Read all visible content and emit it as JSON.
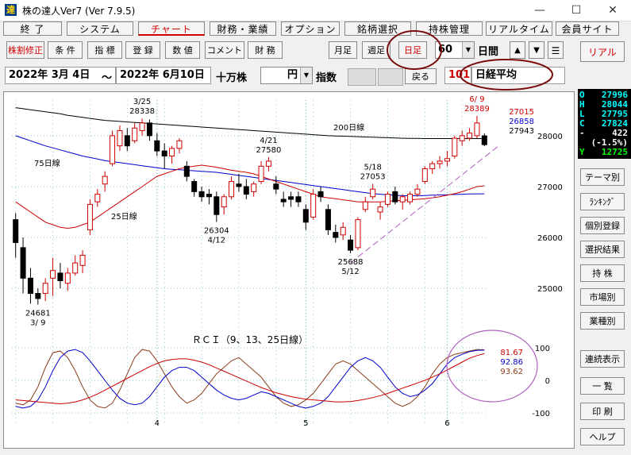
{
  "window": {
    "title": "株の達人Ver7 (Ver 7.9.5)",
    "app_icon": "達"
  },
  "menu": [
    {
      "label": "終 了"
    },
    {
      "label": "システム"
    },
    {
      "label": "チャート"
    },
    {
      "label": "財務・業績"
    },
    {
      "label": "オプション"
    },
    {
      "label": "銘柄選択"
    },
    {
      "label": "持株管理"
    },
    {
      "label": "リアルタイム"
    },
    {
      "label": "会員サイト"
    }
  ],
  "toolbar": {
    "buttons": [
      "株割修正",
      "条 件",
      "指 標",
      "登 録",
      "数 値",
      "コメント",
      "財 務"
    ],
    "period_buttons": [
      "月足",
      "週足",
      "日足"
    ],
    "count": "60",
    "unit": "日間",
    "real_label": "リアル"
  },
  "range": {
    "start": "2022年 3月 4日",
    "sep": "〜",
    "end": "2022年 6月10日",
    "unit1": "十万株",
    "unit2": "円",
    "kind": "指数",
    "back": "戻る",
    "code": "101",
    "name": "日経平均"
  },
  "ohlc": [
    {
      "k": "O",
      "v": "27996",
      "color": "#00ffff"
    },
    {
      "k": "H",
      "v": "28044",
      "color": "#00ffff"
    },
    {
      "k": "L",
      "v": "27795",
      "color": "#00ffff"
    },
    {
      "k": "C",
      "v": "27824",
      "color": "#00ffff"
    },
    {
      "k": "-",
      "v": "422",
      "color": "#ffffff"
    },
    {
      "k": "",
      "v": "(-1.5%)",
      "color": "#ffffff"
    },
    {
      "k": "Y",
      "v": "12725",
      "color": "#00ff00"
    }
  ],
  "side_buttons": [
    "テーマ別",
    "ﾗﾝｷﾝｸﾞ",
    "個別登録",
    "選択結果",
    "持 株",
    "市場別",
    "業種別",
    "連続表示",
    "一 覧",
    "印 刷",
    "ヘルプ"
  ],
  "chart_data": {
    "type": "candlestick",
    "title": "",
    "price_axis": {
      "ticks": [
        28000,
        27000,
        26000,
        25000
      ],
      "ylim": [
        24300,
        28700
      ]
    },
    "x_month_labels": [
      "4",
      "5",
      "6"
    ],
    "candles": [
      {
        "o": 26350,
        "h": 26480,
        "l": 25600,
        "c": 25900
      },
      {
        "o": 25800,
        "h": 26000,
        "l": 24900,
        "c": 25200
      },
      {
        "o": 25200,
        "h": 25400,
        "l": 24700,
        "c": 24900
      },
      {
        "o": 24900,
        "h": 25000,
        "l": 24681,
        "c": 24800
      },
      {
        "o": 24900,
        "h": 25200,
        "l": 24750,
        "c": 25100
      },
      {
        "o": 25200,
        "h": 25600,
        "l": 24850,
        "c": 25350
      },
      {
        "o": 25300,
        "h": 25500,
        "l": 25000,
        "c": 25150
      },
      {
        "o": 25100,
        "h": 25400,
        "l": 24950,
        "c": 25300
      },
      {
        "o": 25300,
        "h": 25650,
        "l": 25250,
        "c": 25500
      },
      {
        "o": 25450,
        "h": 25750,
        "l": 25300,
        "c": 25650
      },
      {
        "o": 26150,
        "h": 26750,
        "l": 26050,
        "c": 26650
      },
      {
        "o": 26700,
        "h": 26950,
        "l": 26600,
        "c": 26850
      },
      {
        "o": 27050,
        "h": 27300,
        "l": 26900,
        "c": 27200
      },
      {
        "o": 27450,
        "h": 28100,
        "l": 27400,
        "c": 28000
      },
      {
        "o": 27800,
        "h": 28200,
        "l": 27700,
        "c": 28100
      },
      {
        "o": 28000,
        "h": 28150,
        "l": 27700,
        "c": 27800
      },
      {
        "o": 27900,
        "h": 28250,
        "l": 27850,
        "c": 28150
      },
      {
        "o": 28100,
        "h": 28338,
        "l": 28000,
        "c": 28250
      },
      {
        "o": 28250,
        "h": 28320,
        "l": 27900,
        "c": 28000
      },
      {
        "o": 27900,
        "h": 28050,
        "l": 27600,
        "c": 27700
      },
      {
        "o": 27700,
        "h": 27850,
        "l": 27350,
        "c": 27600
      },
      {
        "o": 27600,
        "h": 27800,
        "l": 27450,
        "c": 27750
      },
      {
        "o": 27750,
        "h": 27950,
        "l": 27650,
        "c": 27900
      },
      {
        "o": 27400,
        "h": 27500,
        "l": 27100,
        "c": 27200
      },
      {
        "o": 27100,
        "h": 27150,
        "l": 26800,
        "c": 26900
      },
      {
        "o": 26900,
        "h": 27000,
        "l": 26700,
        "c": 26800
      },
      {
        "o": 26850,
        "h": 26950,
        "l": 26650,
        "c": 26800
      },
      {
        "o": 26800,
        "h": 26900,
        "l": 26304,
        "c": 26450
      },
      {
        "o": 26600,
        "h": 26850,
        "l": 26450,
        "c": 26800
      },
      {
        "o": 26800,
        "h": 27200,
        "l": 26750,
        "c": 27100
      },
      {
        "o": 27050,
        "h": 27250,
        "l": 26900,
        "c": 27000
      },
      {
        "o": 27000,
        "h": 27150,
        "l": 26750,
        "c": 26850
      },
      {
        "o": 26900,
        "h": 27100,
        "l": 26800,
        "c": 27050
      },
      {
        "o": 27100,
        "h": 27500,
        "l": 27050,
        "c": 27400
      },
      {
        "o": 27400,
        "h": 27580,
        "l": 27300,
        "c": 27500
      },
      {
        "o": 27050,
        "h": 27200,
        "l": 26850,
        "c": 26950
      },
      {
        "o": 26750,
        "h": 26900,
        "l": 26600,
        "c": 26700
      },
      {
        "o": 26800,
        "h": 26900,
        "l": 26600,
        "c": 26750
      },
      {
        "o": 26800,
        "h": 26900,
        "l": 26600,
        "c": 26700
      },
      {
        "o": 26550,
        "h": 26650,
        "l": 26150,
        "c": 26300
      },
      {
        "o": 26400,
        "h": 26950,
        "l": 26350,
        "c": 26850
      },
      {
        "o": 26900,
        "h": 27000,
        "l": 26700,
        "c": 26800
      },
      {
        "o": 26550,
        "h": 26650,
        "l": 26050,
        "c": 26150
      },
      {
        "o": 26100,
        "h": 26250,
        "l": 25900,
        "c": 26000
      },
      {
        "o": 26050,
        "h": 26300,
        "l": 25950,
        "c": 26200
      },
      {
        "o": 25950,
        "h": 26050,
        "l": 25688,
        "c": 25750
      },
      {
        "o": 25800,
        "h": 26400,
        "l": 25750,
        "c": 26350
      },
      {
        "o": 26550,
        "h": 26800,
        "l": 26500,
        "c": 26700
      },
      {
        "o": 26800,
        "h": 27053,
        "l": 26750,
        "c": 26950
      },
      {
        "o": 26500,
        "h": 26700,
        "l": 26350,
        "c": 26600
      },
      {
        "o": 26650,
        "h": 26900,
        "l": 26600,
        "c": 26850
      },
      {
        "o": 26900,
        "h": 27000,
        "l": 26650,
        "c": 26700
      },
      {
        "o": 26700,
        "h": 26850,
        "l": 26550,
        "c": 26800
      },
      {
        "o": 26700,
        "h": 26900,
        "l": 26650,
        "c": 26850
      },
      {
        "o": 26850,
        "h": 27050,
        "l": 26800,
        "c": 26950
      },
      {
        "o": 27100,
        "h": 27400,
        "l": 27050,
        "c": 27350
      },
      {
        "o": 27350,
        "h": 27500,
        "l": 27250,
        "c": 27450
      },
      {
        "o": 27450,
        "h": 27600,
        "l": 27350,
        "c": 27500
      },
      {
        "o": 27500,
        "h": 27700,
        "l": 27400,
        "c": 27550
      },
      {
        "o": 27600,
        "h": 28000,
        "l": 27550,
        "c": 27950
      },
      {
        "o": 27900,
        "h": 28100,
        "l": 27800,
        "c": 28000
      },
      {
        "o": 27950,
        "h": 28150,
        "l": 27900,
        "c": 28050
      },
      {
        "o": 28000,
        "h": 28389,
        "l": 27950,
        "c": 28250
      },
      {
        "o": 27996,
        "h": 28044,
        "l": 27795,
        "c": 27824
      }
    ],
    "moving_averages": [
      {
        "name": "200日線",
        "color": "#000000",
        "values": [
          28550,
          28530,
          28510,
          28490,
          28470,
          28450,
          28430,
          28400,
          28380,
          28360,
          28340,
          28320,
          28300,
          28290,
          28280,
          28270,
          28260,
          28250,
          28240,
          28230,
          28220,
          28210,
          28200,
          28190,
          28180,
          28170,
          28160,
          28150,
          28140,
          28130,
          28120,
          28110,
          28100,
          28090,
          28080,
          28070,
          28060,
          28050,
          28040,
          28030,
          28020,
          28010,
          28000,
          27995,
          27990,
          27985,
          27980,
          27975,
          27970,
          27965,
          27960,
          27955,
          27950,
          27948,
          27946,
          27944,
          27943,
          27943,
          27943,
          27943,
          27943,
          27943,
          27943,
          27943
        ]
      },
      {
        "name": "75日線",
        "color": "#0000cc",
        "values": [
          28000,
          27950,
          27900,
          27850,
          27800,
          27760,
          27720,
          27680,
          27640,
          27600,
          27570,
          27540,
          27510,
          27490,
          27470,
          27450,
          27430,
          27410,
          27390,
          27370,
          27350,
          27340,
          27330,
          27320,
          27310,
          27300,
          27290,
          27280,
          27260,
          27240,
          27220,
          27200,
          27180,
          27160,
          27140,
          27120,
          27100,
          27080,
          27060,
          27040,
          27020,
          27000,
          26980,
          26960,
          26940,
          26920,
          26900,
          26880,
          26860,
          26850,
          26840,
          26830,
          26820,
          26820,
          26820,
          26825,
          26830,
          26835,
          26840,
          26845,
          26850,
          26855,
          26858,
          26858
        ]
      },
      {
        "name": "25日線",
        "color": "#cc0000",
        "values": [
          26700,
          26600,
          26500,
          26400,
          26300,
          26250,
          26200,
          26180,
          26200,
          26250,
          26300,
          26400,
          26500,
          26600,
          26700,
          26800,
          26900,
          27000,
          27100,
          27200,
          27250,
          27300,
          27350,
          27380,
          27400,
          27420,
          27400,
          27380,
          27350,
          27320,
          27300,
          27280,
          27250,
          27200,
          27150,
          27100,
          27050,
          27000,
          26950,
          26900,
          26850,
          26800,
          26780,
          26760,
          26740,
          26720,
          26700,
          26700,
          26700,
          26700,
          26710,
          26720,
          26730,
          26740,
          26750,
          26760,
          26780,
          26800,
          26830,
          26860,
          26900,
          26950,
          27000,
          27015
        ]
      }
    ],
    "annotations": [
      {
        "date": "3/25",
        "value": "28338"
      },
      {
        "date": "3/ 9",
        "value": "24681"
      },
      {
        "date": "4/21",
        "value": "27580"
      },
      {
        "date": "4/12",
        "value": "26304"
      },
      {
        "date": "5/18",
        "value": "27053"
      },
      {
        "date": "5/12",
        "value": "25688"
      },
      {
        "date": "6/ 9",
        "value": "28389"
      }
    ],
    "ma_labels": [
      "200日線",
      "75日線",
      "25日線"
    ],
    "right_values": [
      {
        "v": "27015",
        "color": "#cc0000"
      },
      {
        "v": "26858",
        "color": "#0000cc"
      },
      {
        "v": "27943",
        "color": "#000000"
      }
    ],
    "rci": {
      "title": "ＲＣＩ（9、13、25日線）",
      "ylim": [
        -100,
        100
      ],
      "ticks": [
        100,
        0,
        -100
      ],
      "values_label": [
        {
          "v": "81.67",
          "color": "#cc0000"
        },
        {
          "v": "92.86",
          "color": "#0000cc"
        },
        {
          "v": "93.62",
          "color": "#8b3a1a"
        }
      ],
      "series": [
        {
          "name": "RCI9",
          "color": "#8b3a1a",
          "values": [
            -70,
            -75,
            -60,
            -20,
            40,
            85,
            90,
            70,
            30,
            -20,
            -60,
            -80,
            -85,
            -70,
            -30,
            20,
            70,
            95,
            90,
            60,
            20,
            -20,
            -50,
            -70,
            -60,
            -40,
            -10,
            20,
            40,
            60,
            70,
            50,
            30,
            10,
            -20,
            -50,
            -70,
            -80,
            -75,
            -60,
            -40,
            -10,
            20,
            50,
            60,
            50,
            30,
            10,
            -10,
            -30,
            -50,
            -70,
            -80,
            -70,
            -50,
            -20,
            20,
            50,
            70,
            80,
            85,
            90,
            95,
            94
          ]
        },
        {
          "name": "RCI13",
          "color": "#0000cc",
          "values": [
            -80,
            -85,
            -80,
            -60,
            -20,
            30,
            70,
            90,
            95,
            85,
            60,
            30,
            0,
            -30,
            -55,
            -70,
            -75,
            -70,
            -50,
            -20,
            10,
            30,
            40,
            40,
            30,
            10,
            -10,
            -30,
            -45,
            -55,
            -60,
            -55,
            -45,
            -35,
            -40,
            -50,
            -60,
            -70,
            -80,
            -85,
            -80,
            -70,
            -50,
            -20,
            10,
            40,
            60,
            70,
            60,
            40,
            10,
            -20,
            -40,
            -50,
            -45,
            -30,
            -10,
            20,
            50,
            70,
            80,
            88,
            92,
            93
          ]
        },
        {
          "name": "RCI25",
          "color": "#cc0000",
          "values": [
            -60,
            -62,
            -64,
            -66,
            -68,
            -70,
            -72,
            -70,
            -66,
            -60,
            -52,
            -42,
            -30,
            -18,
            -6,
            6,
            18,
            30,
            42,
            52,
            60,
            64,
            66,
            66,
            62,
            56,
            48,
            38,
            28,
            18,
            8,
            -2,
            -12,
            -22,
            -30,
            -38,
            -44,
            -50,
            -54,
            -58,
            -60,
            -62,
            -64,
            -66,
            -66,
            -65,
            -62,
            -58,
            -53,
            -47,
            -40,
            -32,
            -24,
            -16,
            -8,
            0,
            10,
            20,
            32,
            44,
            56,
            68,
            76,
            82
          ]
        }
      ]
    }
  }
}
